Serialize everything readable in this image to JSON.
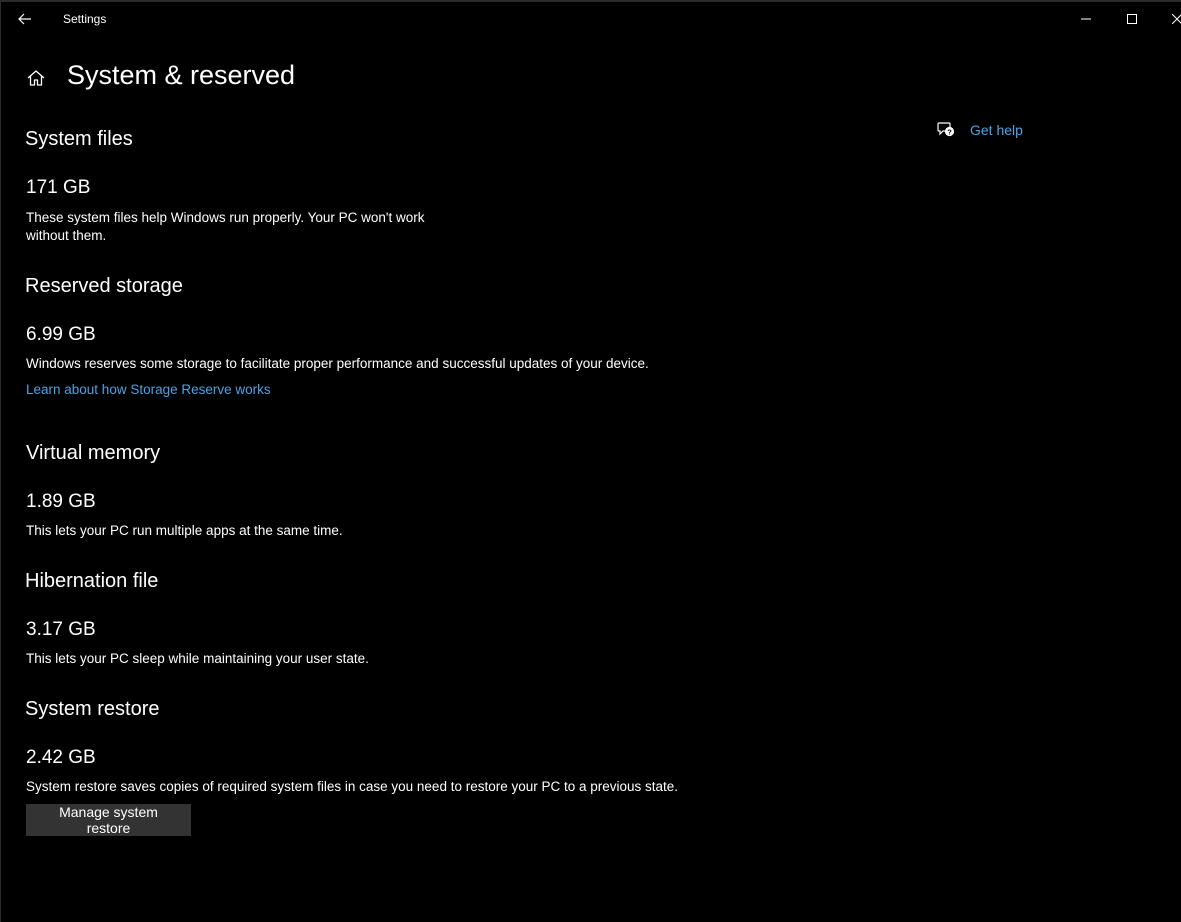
{
  "window": {
    "app_title": "Settings",
    "icons": {
      "back": "back-arrow-icon",
      "minimize": "minimize-icon",
      "maximize": "maximize-icon",
      "close": "close-icon"
    }
  },
  "header": {
    "title": "System & reserved",
    "home_icon": "home-icon"
  },
  "help": {
    "label": "Get help",
    "icon": "chat-help-icon",
    "color": "#4ba3e3"
  },
  "sections": [
    {
      "heading": "System files",
      "size": "171 GB",
      "description_lines": [
        "These system files help Windows run properly. Your PC won't work",
        "without them."
      ]
    },
    {
      "heading": "Reserved storage",
      "size": "6.99 GB",
      "description_lines": [
        "Windows reserves some storage to facilitate proper performance and successful updates of your device."
      ],
      "link": "Learn about how Storage Reserve works"
    },
    {
      "heading": "Virtual memory",
      "size": "1.89 GB",
      "description_lines": [
        "This lets your PC run multiple apps at the same time."
      ]
    },
    {
      "heading": "Hibernation file",
      "size": "3.17 GB",
      "description_lines": [
        "This lets your PC sleep while maintaining your user state."
      ]
    },
    {
      "heading": "System restore",
      "size": "2.42 GB",
      "description_lines": [
        "System restore saves copies of required system files in case you need to restore your PC to a previous state."
      ],
      "button": "Manage system restore"
    }
  ],
  "colors": {
    "background": "#000000",
    "text": "#ffffff",
    "accent_link": "#4ba3e3",
    "button_bg": "#333333"
  }
}
